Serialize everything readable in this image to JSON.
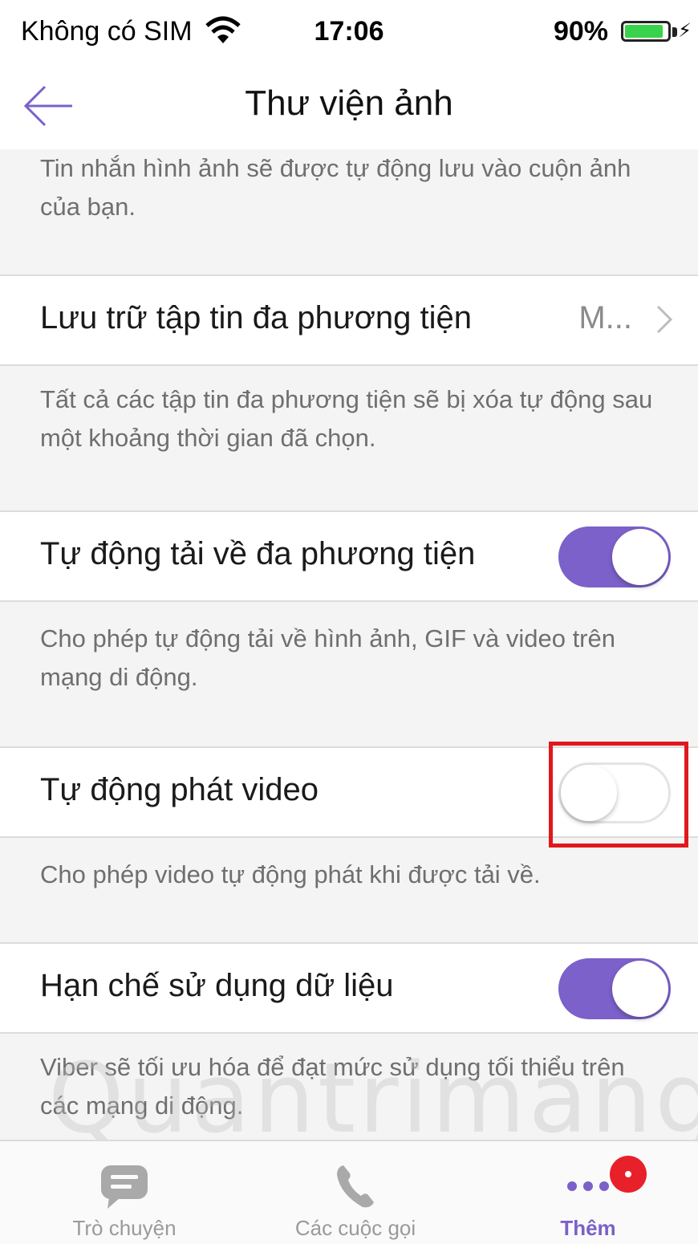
{
  "status_bar": {
    "carrier": "Không có SIM",
    "time": "17:06",
    "battery_percent": "90%",
    "battery_level": 0.9
  },
  "nav": {
    "title": "Thư viện ảnh"
  },
  "sections": [
    {
      "description": "Tin nhắn hình ảnh sẽ được tự động lưu vào cuộn ảnh của bạn."
    },
    {
      "label": "Lưu trữ tập tin đa phương tiện",
      "value": "M...",
      "description": "Tất cả các tập tin đa phương tiện sẽ bị xóa tự động sau một khoảng thời gian đã chọn."
    },
    {
      "label": "Tự động tải về đa phương tiện",
      "toggle": "on",
      "description": "Cho phép tự động tải về hình ảnh, GIF và video trên mạng di động."
    },
    {
      "label": "Tự động phát video",
      "toggle": "off",
      "description": "Cho phép video tự động phát khi được tải về."
    },
    {
      "label": "Hạn chế sử dụng dữ liệu",
      "toggle": "on",
      "description": "Viber sẽ tối ưu hóa để đạt mức sử dụng tối thiểu trên các mạng di động."
    }
  ],
  "tabbar": {
    "tabs": [
      {
        "label": "Trò chuyện",
        "icon": "chat-bubble-icon"
      },
      {
        "label": "Các cuộc gọi",
        "icon": "phone-icon"
      },
      {
        "label": "Thêm",
        "icon": "more-dots-icon",
        "active": true
      }
    ]
  },
  "watermark": "Quantrimang",
  "colors": {
    "accent": "#7b61c9",
    "highlight": "#e0181e",
    "badge": "#e8202a"
  }
}
